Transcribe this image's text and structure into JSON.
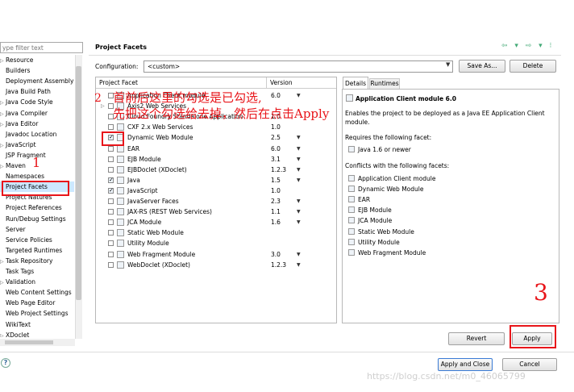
{
  "left_panel": {
    "filter_placeholder": "ype filter text",
    "items": [
      {
        "label": "Resource",
        "expand": "▷",
        "selected": false
      },
      {
        "label": "Builders",
        "expand": "",
        "selected": false
      },
      {
        "label": "Deployment Assembly",
        "expand": "",
        "selected": false
      },
      {
        "label": "Java Build Path",
        "expand": "",
        "selected": false
      },
      {
        "label": "Java Code Style",
        "expand": "▷",
        "selected": false
      },
      {
        "label": "Java Compiler",
        "expand": "▷",
        "selected": false
      },
      {
        "label": "Java Editor",
        "expand": "▷",
        "selected": false
      },
      {
        "label": "Javadoc Location",
        "expand": "",
        "selected": false
      },
      {
        "label": "JavaScript",
        "expand": "▷",
        "selected": false
      },
      {
        "label": "JSP Fragment",
        "expand": "",
        "selected": false
      },
      {
        "label": "Maven",
        "expand": "▷",
        "selected": false
      },
      {
        "label": "Namespaces",
        "expand": "",
        "selected": false
      },
      {
        "label": "Project Facets",
        "expand": "",
        "selected": true
      },
      {
        "label": "Project Natures",
        "expand": "",
        "selected": false
      },
      {
        "label": "Project References",
        "expand": "",
        "selected": false
      },
      {
        "label": "Run/Debug Settings",
        "expand": "",
        "selected": false
      },
      {
        "label": "Server",
        "expand": "",
        "selected": false
      },
      {
        "label": "Service Policies",
        "expand": "",
        "selected": false
      },
      {
        "label": "Targeted Runtimes",
        "expand": "",
        "selected": false
      },
      {
        "label": "Task Repository",
        "expand": "▷",
        "selected": false
      },
      {
        "label": "Task Tags",
        "expand": "",
        "selected": false
      },
      {
        "label": "Validation",
        "expand": "▷",
        "selected": false
      },
      {
        "label": "Web Content Settings",
        "expand": "",
        "selected": false
      },
      {
        "label": "Web Page Editor",
        "expand": "",
        "selected": false
      },
      {
        "label": "Web Project Settings",
        "expand": "",
        "selected": false
      },
      {
        "label": "WikiText",
        "expand": "",
        "selected": false
      },
      {
        "label": "XDoclet",
        "expand": "▷",
        "selected": false
      }
    ]
  },
  "header": {
    "title": "Project Facets",
    "icons": "⇦ ▾ ⇨ ▾ ⁝"
  },
  "configuration": {
    "label": "Configuration:",
    "value": "<custom>",
    "save_as_label": "Save As...",
    "delete_label": "Delete"
  },
  "facets_table": {
    "col_facet": "Project Facet",
    "col_version": "Version",
    "rows": [
      {
        "name": "Application Client module",
        "version": "6.0",
        "checked": false,
        "dropdown": true,
        "expand": ""
      },
      {
        "name": "Axis2 Web Services",
        "version": "",
        "checked": false,
        "dropdown": false,
        "expand": "▷"
      },
      {
        "name": "Cloud Foundry Standalone Application",
        "version": "1.0",
        "checked": false,
        "dropdown": false,
        "expand": ""
      },
      {
        "name": "CXF 2.x Web Services",
        "version": "1.0",
        "checked": false,
        "dropdown": false,
        "expand": ""
      },
      {
        "name": "Dynamic Web Module",
        "version": "2.5",
        "checked": true,
        "dropdown": true,
        "expand": ""
      },
      {
        "name": "EAR",
        "version": "6.0",
        "checked": false,
        "dropdown": true,
        "expand": ""
      },
      {
        "name": "EJB Module",
        "version": "3.1",
        "checked": false,
        "dropdown": true,
        "expand": ""
      },
      {
        "name": "EJBDoclet (XDoclet)",
        "version": "1.2.3",
        "checked": false,
        "dropdown": true,
        "expand": ""
      },
      {
        "name": "Java",
        "version": "1.5",
        "checked": true,
        "dropdown": true,
        "expand": ""
      },
      {
        "name": "JavaScript",
        "version": "1.0",
        "checked": true,
        "dropdown": false,
        "expand": ""
      },
      {
        "name": "JavaServer Faces",
        "version": "2.3",
        "checked": false,
        "dropdown": true,
        "expand": ""
      },
      {
        "name": "JAX-RS (REST Web Services)",
        "version": "1.1",
        "checked": false,
        "dropdown": true,
        "expand": ""
      },
      {
        "name": "JCA Module",
        "version": "1.6",
        "checked": false,
        "dropdown": true,
        "expand": ""
      },
      {
        "name": "Static Web Module",
        "version": "",
        "checked": false,
        "dropdown": false,
        "expand": ""
      },
      {
        "name": "Utility Module",
        "version": "",
        "checked": false,
        "dropdown": false,
        "expand": ""
      },
      {
        "name": "Web Fragment Module",
        "version": "3.0",
        "checked": false,
        "dropdown": true,
        "expand": ""
      },
      {
        "name": "WebDoclet (XDoclet)",
        "version": "1.2.3",
        "checked": false,
        "dropdown": true,
        "expand": ""
      }
    ]
  },
  "details": {
    "tab_details": "Details",
    "tab_runtimes": "Runtimes",
    "title": "Application Client module 6.0",
    "description": "Enables the project to be deployed as a Java EE Application Client module.",
    "requires_label": "Requires the following facet:",
    "requires": [
      "Java 1.6 or newer"
    ],
    "conflicts_label": "Conflicts with the following facets:",
    "conflicts": [
      "Application Client module",
      "Dynamic Web Module",
      "EAR",
      "EJB Module",
      "JCA Module",
      "Static Web Module",
      "Utility Module",
      "Web Fragment Module"
    ]
  },
  "buttons": {
    "revert": "Revert",
    "apply": "Apply",
    "apply_close": "Apply and Close",
    "cancel": "Cancel",
    "help": "?"
  },
  "annotations": {
    "n1": "1",
    "n2": "2",
    "n3": "3",
    "line1": "首前后这里的勾选是已勾选,",
    "line2": "先把这个勾选给去掉，然后在点击Apply"
  },
  "watermark": "https://blog.csdn.net/m0_46065799",
  "colors": {
    "annotation_red": "#e8151a",
    "selection": "#cde8ff"
  }
}
